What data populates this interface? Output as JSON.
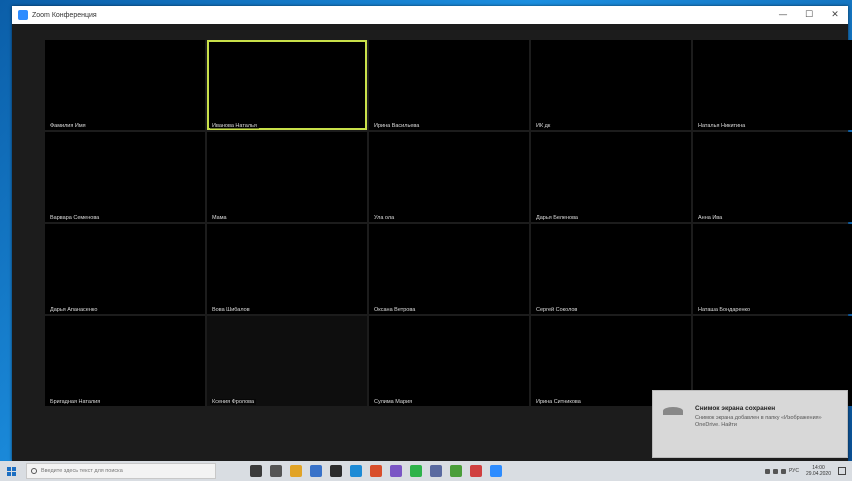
{
  "window": {
    "title": "Zoom Конференция",
    "minimize": "—",
    "maximize": "☐",
    "close": "✕"
  },
  "participants": [
    {
      "name": "Фамилия Имя",
      "bg": "#6b5a4c",
      "accent": "#2a2a2a"
    },
    {
      "name": "Иванова Наталья",
      "bg": "#c8bca6",
      "accent": "#c9a58f",
      "active": true
    },
    {
      "name": "Ирина Васильева",
      "bg": "#2f3d66",
      "accent": "#e9dcd2"
    },
    {
      "name": "ИК дк",
      "bg": "#4a3a3a",
      "accent": "#44a6c6"
    },
    {
      "name": "Наталья Никитина",
      "bg": "#d9cbc4",
      "accent": "#c76fa0"
    },
    {
      "name": "Варвара Семенова",
      "bg": "#3b3e45",
      "accent": "#d8c2a8"
    },
    {
      "name": "Мама",
      "bg": "#a99a8e",
      "accent": "#7b6a5f"
    },
    {
      "name": "Ула ола",
      "bg": "#b07a88",
      "accent": "#6ec0a5"
    },
    {
      "name": "Дарья Беленова",
      "bg": "#cfc4b6",
      "accent": "#5b8fbe"
    },
    {
      "name": "Анна Ива",
      "bg": "#8b7564",
      "accent": "#d7b58b"
    },
    {
      "name": "Дарья Апанасенко",
      "bg": "#b19a6e",
      "accent": "#c94f5b"
    },
    {
      "name": "Вова Шибалов",
      "bg": "#7a5a3e",
      "accent": "#2d3d6a"
    },
    {
      "name": "Оксана Ветрова",
      "bg": "#c7bcae",
      "accent": "#bf7fb3"
    },
    {
      "name": "Сергей Соколов",
      "bg": "#dedad6",
      "accent": "#3c5fa5"
    },
    {
      "name": "Наташа Бондаренко",
      "bg": "#d1cfcc",
      "accent": "#3b62b5"
    },
    {
      "name": "Бригадная Наталия",
      "bg": "#2d3a5e",
      "accent": "#f2e21b"
    },
    {
      "name": "Ксения Фролова",
      "bg": "#0e0e0e",
      "accent": "#0e0e0e"
    },
    {
      "name": "Сулима Мария",
      "bg": "#a09a94",
      "accent": "#2f2a28"
    },
    {
      "name": "Ирина Ситникова",
      "bg": "#c2b8ac",
      "accent": "#8a8a8a"
    },
    {
      "name": "",
      "bg": "#b8a596",
      "accent": "#3c3032"
    }
  ],
  "toast": {
    "title": "Снимок экрана сохранен",
    "body": "Снимок экрана добавлен в папку «Изображения» OneDrive. Найти"
  },
  "taskbar": {
    "search_placeholder": "Введите здесь текст для поиска",
    "time": "14:00",
    "date": "29.04.2020",
    "lang": "РУС",
    "icons": [
      "#3b3b3b",
      "#555",
      "#e1a326",
      "#3872c9",
      "#2c2c2c",
      "#1d8bd6",
      "#d94f2b",
      "#7b56c5",
      "#2eb34a",
      "#5a6aa0",
      "#4a9e3a",
      "#d04040",
      "#2d8cff"
    ]
  }
}
